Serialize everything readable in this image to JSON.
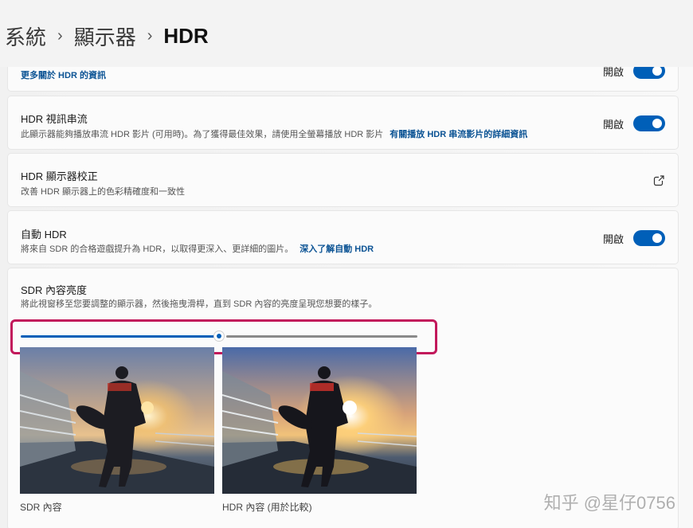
{
  "breadcrumb": {
    "items": [
      "系統",
      "顯示器"
    ],
    "current": "HDR",
    "separator": "›"
  },
  "partial_row": {
    "link": "更多關於 HDR 的資訊",
    "state": "開啟"
  },
  "hdr_streaming": {
    "title": "HDR 視訊串流",
    "desc": "此顯示器能夠播放串流 HDR 影片 (可用時)。為了獲得最佳效果，請使用全螢幕播放 HDR 影片",
    "link": "有關播放 HDR 串流影片的詳細資訊",
    "state": "開啟",
    "enabled": true
  },
  "calibration": {
    "title": "HDR 顯示器校正",
    "desc": "改善 HDR 顯示器上的色彩精確度和一致性",
    "icon": "external-link-icon"
  },
  "auto_hdr": {
    "title": "自動 HDR",
    "desc": "將來自 SDR 的合格遊戲提升為 HDR，以取得更深入、更詳細的圖片。",
    "link": "深入了解自動 HDR",
    "state": "開啟",
    "enabled": true
  },
  "sdr_brightness": {
    "title": "SDR 內容亮度",
    "desc": "將此視窗移至您要調整的顯示器，然後拖曳滑桿，直到 SDR 內容的亮度呈現您想要的樣子。",
    "slider_value": 0.5,
    "sdr_caption": "SDR 內容",
    "hdr_caption": "HDR 內容 (用於比較)"
  },
  "watermark": "知乎 @星仔0756",
  "colors": {
    "accent": "#005fb8",
    "highlight": "#c2185b",
    "link": "#0b5394"
  }
}
